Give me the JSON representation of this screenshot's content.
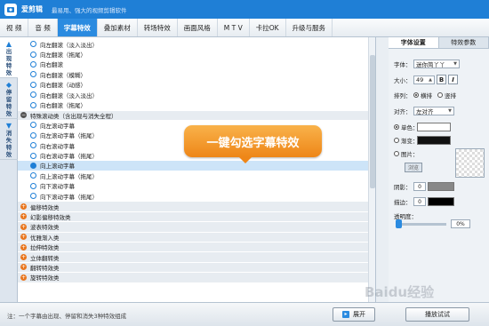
{
  "app": {
    "name": "爱剪辑",
    "tagline": "最易用、强大的视频剪辑软件"
  },
  "menu": [
    {
      "label": "视  频",
      "active": false
    },
    {
      "label": "音  频",
      "active": false
    },
    {
      "label": "字幕特效",
      "active": true
    },
    {
      "label": "叠加素材",
      "active": false
    },
    {
      "label": "转场特效",
      "active": false
    },
    {
      "label": "画面风格",
      "active": false
    },
    {
      "label": "M T V",
      "active": false
    },
    {
      "label": "卡拉OK",
      "active": false
    },
    {
      "label": "升级与服务",
      "active": false
    }
  ],
  "side_tabs": [
    {
      "label": "出现特效",
      "icon": "▲"
    },
    {
      "label": "停留特效",
      "icon": "◆"
    },
    {
      "label": "消失特效",
      "icon": "▼"
    }
  ],
  "effect_list": [
    {
      "kind": "child",
      "text": "向左翻滚（淡入淡出）"
    },
    {
      "kind": "child",
      "text": "向左翻滚（拖尾）"
    },
    {
      "kind": "child",
      "text": "向右翻滚"
    },
    {
      "kind": "child",
      "text": "向右翻滚（模糊）"
    },
    {
      "kind": "child",
      "text": "向右翻滚（动感）"
    },
    {
      "kind": "child",
      "text": "向右翻滚（淡入淡出）"
    },
    {
      "kind": "child",
      "text": "向右翻滚（拖尾）"
    },
    {
      "kind": "category-open",
      "text": "特殊滚动类（含出现与消失全程）"
    },
    {
      "kind": "child",
      "text": "向左滚动字幕"
    },
    {
      "kind": "child",
      "text": "向左滚动字幕（拖尾）"
    },
    {
      "kind": "child",
      "text": "向右滚动字幕"
    },
    {
      "kind": "child",
      "text": "向右滚动字幕（拖尾）"
    },
    {
      "kind": "selected",
      "text": "向上滚动字幕"
    },
    {
      "kind": "child",
      "text": "向上滚动字幕（拖尾）"
    },
    {
      "kind": "child",
      "text": "向下滚动字幕"
    },
    {
      "kind": "child",
      "text": "向下滚动字幕（拖尾）"
    },
    {
      "kind": "category",
      "text": "偏移特效类"
    },
    {
      "kind": "category",
      "text": "幻影偏移特效类"
    },
    {
      "kind": "category",
      "text": "波表特效类"
    },
    {
      "kind": "category",
      "text": "优雅渐入类"
    },
    {
      "kind": "category",
      "text": "拉伸特效类"
    },
    {
      "kind": "category",
      "text": "立体翻转类"
    },
    {
      "kind": "category",
      "text": "翻转特效类"
    },
    {
      "kind": "category",
      "text": "旋转特效类"
    }
  ],
  "callout": "一键勾选字幕特效",
  "right_tabs": [
    "字体设置",
    "特效参数"
  ],
  "font_settings": {
    "font_label": "字体：",
    "font_value": "迷你简丫丫",
    "size_label": "大小：",
    "size_value": "49",
    "bold_label": "B",
    "italic_label": "I",
    "arrange_label": "排列：",
    "arrange_horizontal": "横排",
    "arrange_vertical": "竖排",
    "align_label": "对齐：",
    "align_value": "左对齐",
    "solid_label": "单色：",
    "gradient_label": "渐变：",
    "image_label": "图片：",
    "browse_label": "浏览",
    "shadow_label": "阴影：",
    "shadow_value": "0",
    "stroke_label": "描边：",
    "stroke_value": "0",
    "opacity_label": "透明度：",
    "opacity_value": "0%",
    "opacity_level": 0
  },
  "colors": {
    "accent": "#1f7fd6",
    "callout": "#ee8618",
    "solid_swatch": "#ffffff",
    "gradient_swatch": "#111111",
    "shadow_swatch": "#888888",
    "stroke_swatch": "#000000"
  },
  "bottom": {
    "footnote": "注：一个字幕由出现、停留和消失3种特效组成",
    "expand_label": "展开",
    "preview_label": "播放试试"
  },
  "watermark": "Baidu经验"
}
